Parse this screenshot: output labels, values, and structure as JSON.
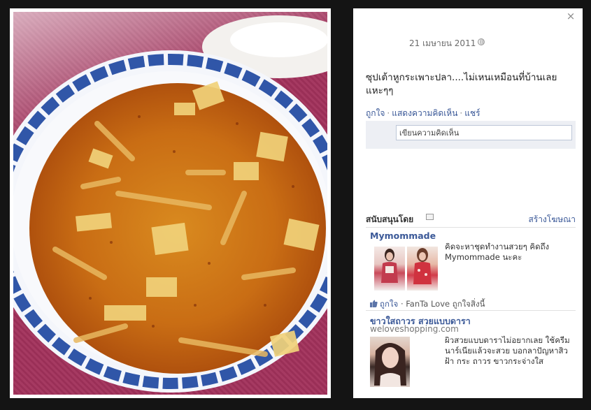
{
  "photo": {
    "alt": "hot and sour fish maw soup in a blue and white porcelain bowl"
  },
  "panel": {
    "close_symbol": "×",
    "post_date": "21 เมษายน 2011",
    "caption": "ซุปเต้าหูกระเพาะปลา....ไม่เหนเหมือนที่บ้านเลย แหะๆๆ",
    "actions": {
      "like": "ถูกใจ",
      "comment": "แสดงความคิดเห็น",
      "share": "แชร์",
      "separator": "·"
    },
    "comment_placeholder": "เขียนความคิดเห็น"
  },
  "sponsored": {
    "title": "สนับสนุนโดย",
    "create_ad": "สร้างโฆษณา",
    "ads": [
      {
        "title": "Mymommade",
        "text": "คิดจะหาชุดทำงานสวยๆ คิดถึง Mymommade นะคะ",
        "like_prefix": "ถูกใจ",
        "like_separator": "·",
        "like_text": "FanTa Love ถูกใจสิ่งนี้"
      },
      {
        "title": "ขาวใสถาวร สวยแบบดารา",
        "domain": "weloveshopping.com",
        "text": "ผิวสวยแบบดาราไม่อยากเลย ใช้ครีมนาร์เนียแล้วจะสวย บอกลาปัญหาสิว ฝ้า กระ ถาวร ขาวกระจ่างใส"
      }
    ]
  },
  "colors": {
    "link": "#3b5998",
    "background": "#141414",
    "panel": "#ffffff"
  }
}
